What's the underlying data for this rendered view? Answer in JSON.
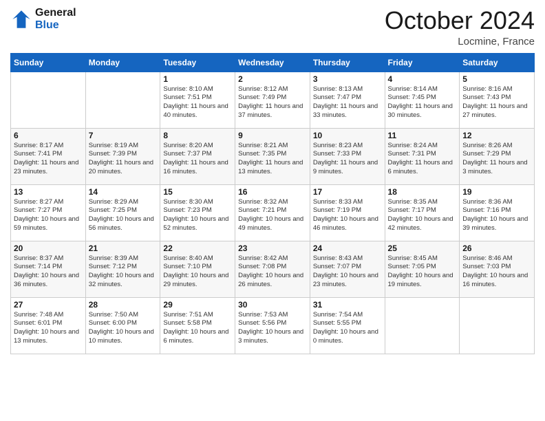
{
  "header": {
    "logo_line1": "General",
    "logo_line2": "Blue",
    "month_title": "October 2024",
    "location": "Locmine, France"
  },
  "days_of_week": [
    "Sunday",
    "Monday",
    "Tuesday",
    "Wednesday",
    "Thursday",
    "Friday",
    "Saturday"
  ],
  "weeks": [
    [
      {
        "day": "",
        "info": ""
      },
      {
        "day": "",
        "info": ""
      },
      {
        "day": "1",
        "info": "Sunrise: 8:10 AM\nSunset: 7:51 PM\nDaylight: 11 hours and 40 minutes."
      },
      {
        "day": "2",
        "info": "Sunrise: 8:12 AM\nSunset: 7:49 PM\nDaylight: 11 hours and 37 minutes."
      },
      {
        "day": "3",
        "info": "Sunrise: 8:13 AM\nSunset: 7:47 PM\nDaylight: 11 hours and 33 minutes."
      },
      {
        "day": "4",
        "info": "Sunrise: 8:14 AM\nSunset: 7:45 PM\nDaylight: 11 hours and 30 minutes."
      },
      {
        "day": "5",
        "info": "Sunrise: 8:16 AM\nSunset: 7:43 PM\nDaylight: 11 hours and 27 minutes."
      }
    ],
    [
      {
        "day": "6",
        "info": "Sunrise: 8:17 AM\nSunset: 7:41 PM\nDaylight: 11 hours and 23 minutes."
      },
      {
        "day": "7",
        "info": "Sunrise: 8:19 AM\nSunset: 7:39 PM\nDaylight: 11 hours and 20 minutes."
      },
      {
        "day": "8",
        "info": "Sunrise: 8:20 AM\nSunset: 7:37 PM\nDaylight: 11 hours and 16 minutes."
      },
      {
        "day": "9",
        "info": "Sunrise: 8:21 AM\nSunset: 7:35 PM\nDaylight: 11 hours and 13 minutes."
      },
      {
        "day": "10",
        "info": "Sunrise: 8:23 AM\nSunset: 7:33 PM\nDaylight: 11 hours and 9 minutes."
      },
      {
        "day": "11",
        "info": "Sunrise: 8:24 AM\nSunset: 7:31 PM\nDaylight: 11 hours and 6 minutes."
      },
      {
        "day": "12",
        "info": "Sunrise: 8:26 AM\nSunset: 7:29 PM\nDaylight: 11 hours and 3 minutes."
      }
    ],
    [
      {
        "day": "13",
        "info": "Sunrise: 8:27 AM\nSunset: 7:27 PM\nDaylight: 10 hours and 59 minutes."
      },
      {
        "day": "14",
        "info": "Sunrise: 8:29 AM\nSunset: 7:25 PM\nDaylight: 10 hours and 56 minutes."
      },
      {
        "day": "15",
        "info": "Sunrise: 8:30 AM\nSunset: 7:23 PM\nDaylight: 10 hours and 52 minutes."
      },
      {
        "day": "16",
        "info": "Sunrise: 8:32 AM\nSunset: 7:21 PM\nDaylight: 10 hours and 49 minutes."
      },
      {
        "day": "17",
        "info": "Sunrise: 8:33 AM\nSunset: 7:19 PM\nDaylight: 10 hours and 46 minutes."
      },
      {
        "day": "18",
        "info": "Sunrise: 8:35 AM\nSunset: 7:17 PM\nDaylight: 10 hours and 42 minutes."
      },
      {
        "day": "19",
        "info": "Sunrise: 8:36 AM\nSunset: 7:16 PM\nDaylight: 10 hours and 39 minutes."
      }
    ],
    [
      {
        "day": "20",
        "info": "Sunrise: 8:37 AM\nSunset: 7:14 PM\nDaylight: 10 hours and 36 minutes."
      },
      {
        "day": "21",
        "info": "Sunrise: 8:39 AM\nSunset: 7:12 PM\nDaylight: 10 hours and 32 minutes."
      },
      {
        "day": "22",
        "info": "Sunrise: 8:40 AM\nSunset: 7:10 PM\nDaylight: 10 hours and 29 minutes."
      },
      {
        "day": "23",
        "info": "Sunrise: 8:42 AM\nSunset: 7:08 PM\nDaylight: 10 hours and 26 minutes."
      },
      {
        "day": "24",
        "info": "Sunrise: 8:43 AM\nSunset: 7:07 PM\nDaylight: 10 hours and 23 minutes."
      },
      {
        "day": "25",
        "info": "Sunrise: 8:45 AM\nSunset: 7:05 PM\nDaylight: 10 hours and 19 minutes."
      },
      {
        "day": "26",
        "info": "Sunrise: 8:46 AM\nSunset: 7:03 PM\nDaylight: 10 hours and 16 minutes."
      }
    ],
    [
      {
        "day": "27",
        "info": "Sunrise: 7:48 AM\nSunset: 6:01 PM\nDaylight: 10 hours and 13 minutes."
      },
      {
        "day": "28",
        "info": "Sunrise: 7:50 AM\nSunset: 6:00 PM\nDaylight: 10 hours and 10 minutes."
      },
      {
        "day": "29",
        "info": "Sunrise: 7:51 AM\nSunset: 5:58 PM\nDaylight: 10 hours and 6 minutes."
      },
      {
        "day": "30",
        "info": "Sunrise: 7:53 AM\nSunset: 5:56 PM\nDaylight: 10 hours and 3 minutes."
      },
      {
        "day": "31",
        "info": "Sunrise: 7:54 AM\nSunset: 5:55 PM\nDaylight: 10 hours and 0 minutes."
      },
      {
        "day": "",
        "info": ""
      },
      {
        "day": "",
        "info": ""
      }
    ]
  ]
}
